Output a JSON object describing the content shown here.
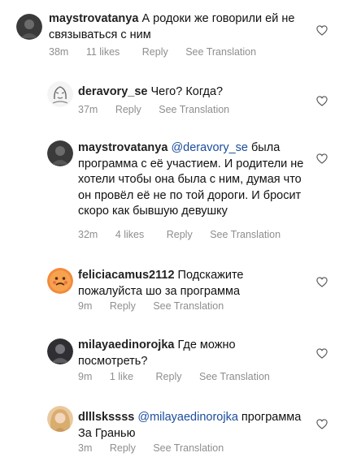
{
  "ui": {
    "reply_label": "Reply",
    "translation_label": "See Translation"
  },
  "comments": [
    {
      "username": "maystrovatanya",
      "mention": "",
      "text": "А родоки же говорили ей не связываться с ним",
      "time": "38m",
      "likes": "11 likes",
      "avatar_icon": "dark-photo-avatar"
    },
    {
      "username": "deravory_se",
      "mention": "",
      "text": "Чего? Когда?",
      "time": "37m",
      "likes": "",
      "avatar_icon": "sketch-avatar"
    },
    {
      "username": "maystrovatanya",
      "mention": "@deravory_se",
      "text": "была программа с её участием. И родители не хотели чтобы она была с ним, думая что он провёл её не по той дороги. И бросит скоро как бывшую девушку",
      "time": "32m",
      "likes": "4 likes",
      "avatar_icon": "dark-photo-avatar"
    },
    {
      "username": "feliciacamus2112",
      "mention": "",
      "text": "Подскажите пожалуйста шо за программа",
      "time": "9m",
      "likes": "",
      "avatar_icon": "emoji-avatar"
    },
    {
      "username": "milayaedinorojka",
      "mention": "",
      "text": "Где можно посмотреть?",
      "time": "9m",
      "likes": "1 like",
      "avatar_icon": "dark-photo-avatar"
    },
    {
      "username": "dlllskssss",
      "mention": "@milayaedinorojka",
      "text": "программа За Гранью",
      "time": "3m",
      "likes": "",
      "avatar_icon": "blonde-photo-avatar"
    }
  ]
}
